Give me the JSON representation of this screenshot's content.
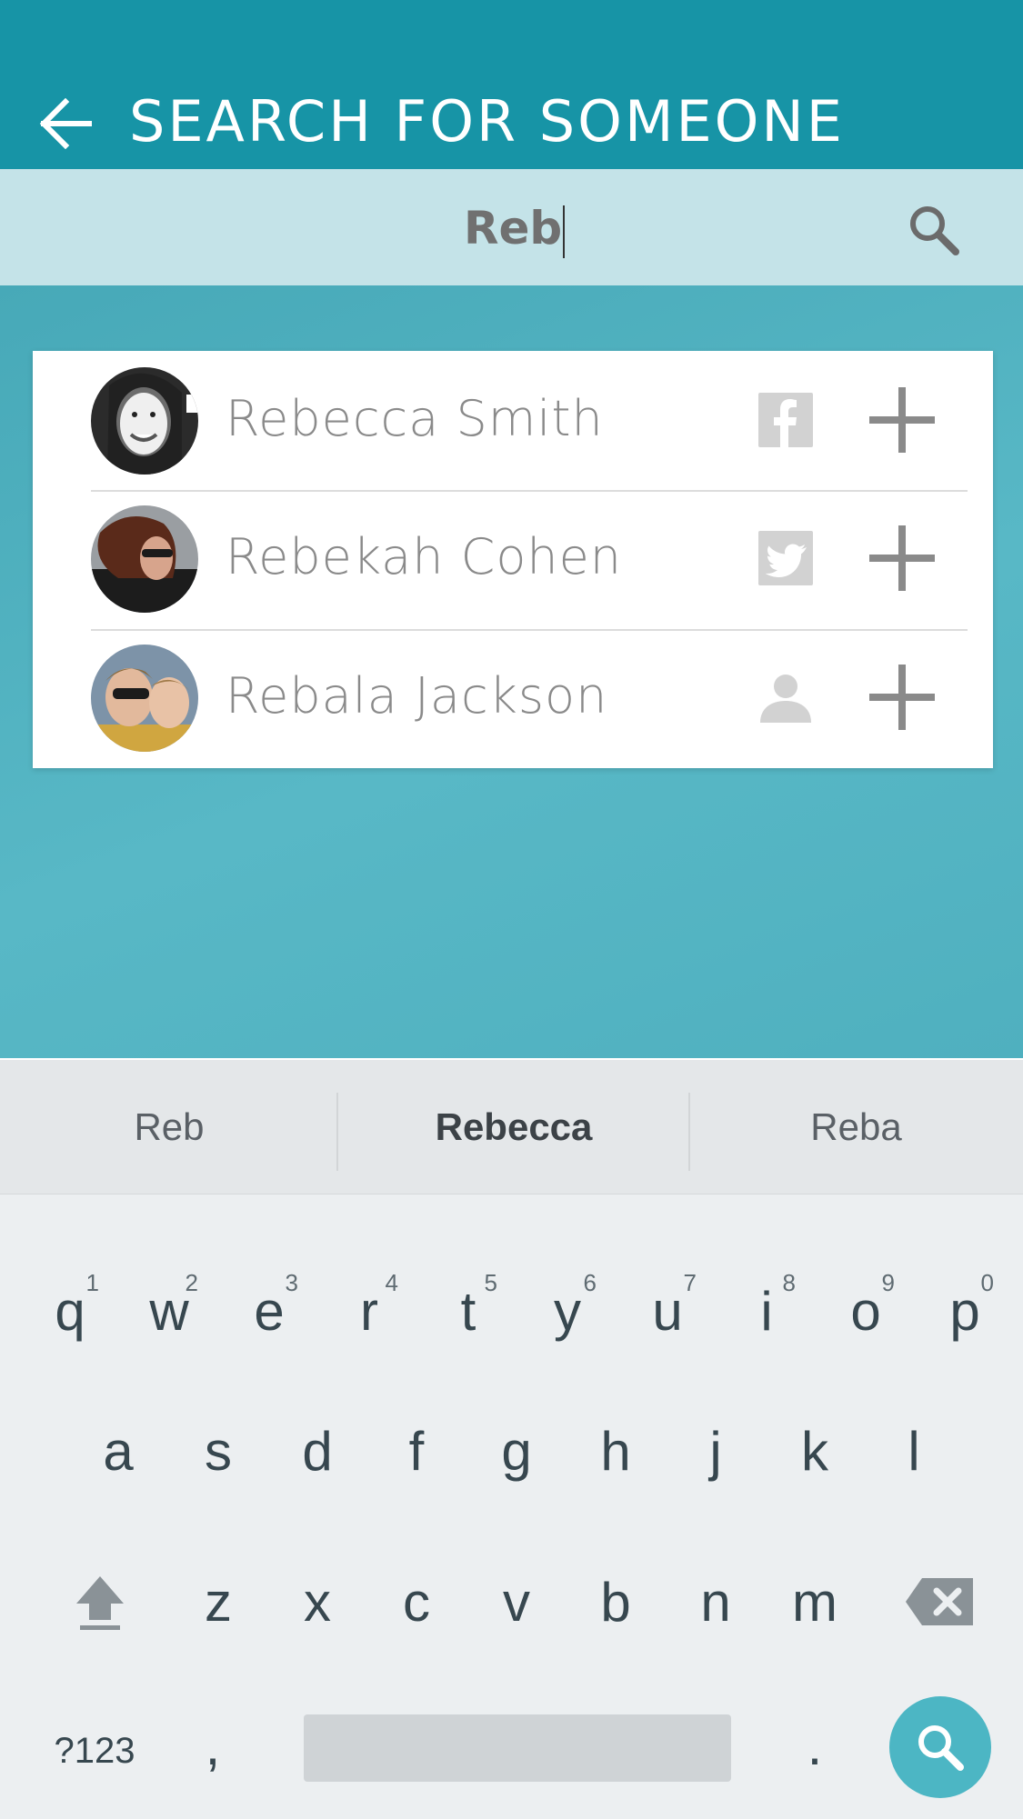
{
  "header": {
    "title": "SEARCH FOR SOMEONE",
    "back_icon": "arrow-left-icon",
    "background": "#1794a6"
  },
  "search": {
    "value": "Reb",
    "icon": "search-icon",
    "background": "#c4e3e8"
  },
  "results": [
    {
      "name": "Rebecca Smith",
      "source": "facebook-icon",
      "action": "plus-icon"
    },
    {
      "name": "Rebekah Cohen",
      "source": "twitter-icon",
      "action": "plus-icon"
    },
    {
      "name": "Rebala Jackson",
      "source": "person-icon",
      "action": "plus-icon"
    }
  ],
  "keyboard": {
    "suggestions": [
      "Reb",
      "Rebecca",
      "Reba"
    ],
    "row1": [
      {
        "key": "q",
        "hint": "1"
      },
      {
        "key": "w",
        "hint": "2"
      },
      {
        "key": "e",
        "hint": "3"
      },
      {
        "key": "r",
        "hint": "4"
      },
      {
        "key": "t",
        "hint": "5"
      },
      {
        "key": "y",
        "hint": "6"
      },
      {
        "key": "u",
        "hint": "7"
      },
      {
        "key": "i",
        "hint": "8"
      },
      {
        "key": "o",
        "hint": "9"
      },
      {
        "key": "p",
        "hint": "0"
      }
    ],
    "row2": [
      "a",
      "s",
      "d",
      "f",
      "g",
      "h",
      "j",
      "k",
      "l"
    ],
    "row3": [
      "z",
      "x",
      "c",
      "v",
      "b",
      "n",
      "m"
    ],
    "symbols_label": "?123",
    "comma": ",",
    "period": ".",
    "accent": "#4cb6c4"
  }
}
